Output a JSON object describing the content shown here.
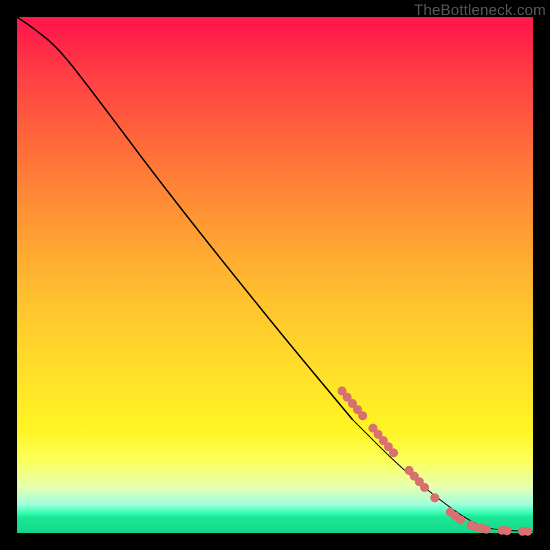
{
  "watermark": "TheBottleneck.com",
  "chart_data": {
    "type": "line",
    "title": "",
    "xlabel": "",
    "ylabel": "",
    "xlim": [
      0,
      100
    ],
    "ylim": [
      0,
      100
    ],
    "curve": [
      {
        "x": 0,
        "y": 100
      },
      {
        "x": 3,
        "y": 98
      },
      {
        "x": 8,
        "y": 94
      },
      {
        "x": 15,
        "y": 85
      },
      {
        "x": 30,
        "y": 65
      },
      {
        "x": 50,
        "y": 40
      },
      {
        "x": 65,
        "y": 22
      },
      {
        "x": 75,
        "y": 12
      },
      {
        "x": 85,
        "y": 4
      },
      {
        "x": 90,
        "y": 1.2
      },
      {
        "x": 93,
        "y": 0.6
      },
      {
        "x": 96,
        "y": 0.4
      },
      {
        "x": 100,
        "y": 0.3
      }
    ],
    "markers": [
      {
        "x": 63,
        "y": 27.5
      },
      {
        "x": 64,
        "y": 26.3
      },
      {
        "x": 65,
        "y": 25.1
      },
      {
        "x": 66,
        "y": 23.9
      },
      {
        "x": 67,
        "y": 22.7
      },
      {
        "x": 69,
        "y": 20.3
      },
      {
        "x": 70,
        "y": 19.1
      },
      {
        "x": 71,
        "y": 17.9
      },
      {
        "x": 72,
        "y": 16.7
      },
      {
        "x": 73,
        "y": 15.5
      },
      {
        "x": 76,
        "y": 12.1
      },
      {
        "x": 77,
        "y": 11.0
      },
      {
        "x": 78,
        "y": 9.9
      },
      {
        "x": 79,
        "y": 8.8
      },
      {
        "x": 81,
        "y": 6.8
      },
      {
        "x": 84,
        "y": 4.0
      },
      {
        "x": 85,
        "y": 3.2
      },
      {
        "x": 86,
        "y": 2.5
      },
      {
        "x": 88,
        "y": 1.5
      },
      {
        "x": 89,
        "y": 1.1
      },
      {
        "x": 90,
        "y": 0.9
      },
      {
        "x": 91,
        "y": 0.7
      },
      {
        "x": 94,
        "y": 0.5
      },
      {
        "x": 95,
        "y": 0.4
      },
      {
        "x": 98,
        "y": 0.3
      },
      {
        "x": 99,
        "y": 0.3
      }
    ],
    "background_gradient": {
      "top": "#ff1a4a",
      "mid": "#ffe128",
      "bottom": "#12d88a"
    }
  }
}
